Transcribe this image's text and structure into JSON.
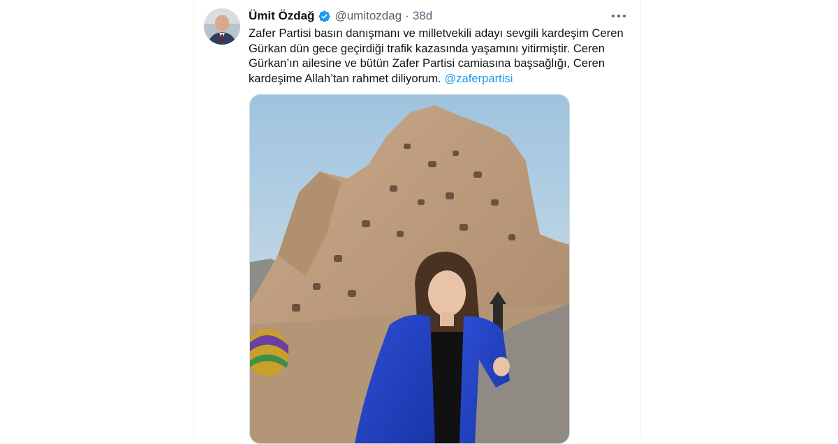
{
  "tweet": {
    "author_name": "Ümit Özdağ",
    "handle": "@umitozdag",
    "separator": "·",
    "time": "38d",
    "text_main": "Zafer Partisi basın danışmanı ve milletvekili adayı sevgili kardeşim Ceren Gürkan dün gece geçirdiği trafik kazasında yaşamını yitirmiştir. Ceren Gürkan’ın ailesine ve bütün Zafer Partisi camiasına başsağlığı, Ceren kardeşime Allah’tan rahmet diliyorum.",
    "mention": "@zaferpartisi"
  },
  "icons": {
    "verified": "verified-badge-icon",
    "more": "more-options-icon"
  },
  "colors": {
    "link": "#1d9bf0",
    "verified": "#1d9bf0",
    "text": "#0f1419",
    "muted": "#536471"
  }
}
